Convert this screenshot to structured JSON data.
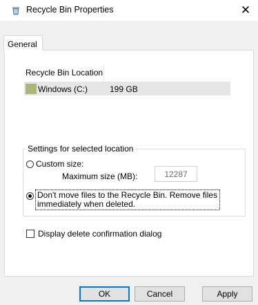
{
  "window": {
    "title": "Recycle Bin Properties",
    "app_icon": "recycle-bin-icon",
    "close_glyph": "✕"
  },
  "tabs": [
    {
      "label": "General",
      "selected": true
    }
  ],
  "location_list": {
    "header": "Recycle Bin Location",
    "rows": [
      {
        "icon": "drive-icon",
        "name": "Windows (C:)",
        "size": "199 GB",
        "selected": true
      }
    ]
  },
  "settings": {
    "group_label": "Settings for selected location",
    "custom_size_label": "Custom size:",
    "custom_size_selected": false,
    "max_size_label": "Maximum size (MB):",
    "max_size_value": "12287",
    "dont_move_label": "Don't move files to the Recycle Bin. Remove files immediately when deleted.",
    "dont_move_selected": true
  },
  "confirm_dialog": {
    "label": "Display delete confirmation dialog",
    "checked": false
  },
  "buttons": {
    "ok": "OK",
    "cancel": "Cancel",
    "apply": "Apply"
  },
  "colors": {
    "accent": "#0078d7",
    "selected_row": "#e6e6e6",
    "drive_icon": "#a8b878"
  }
}
